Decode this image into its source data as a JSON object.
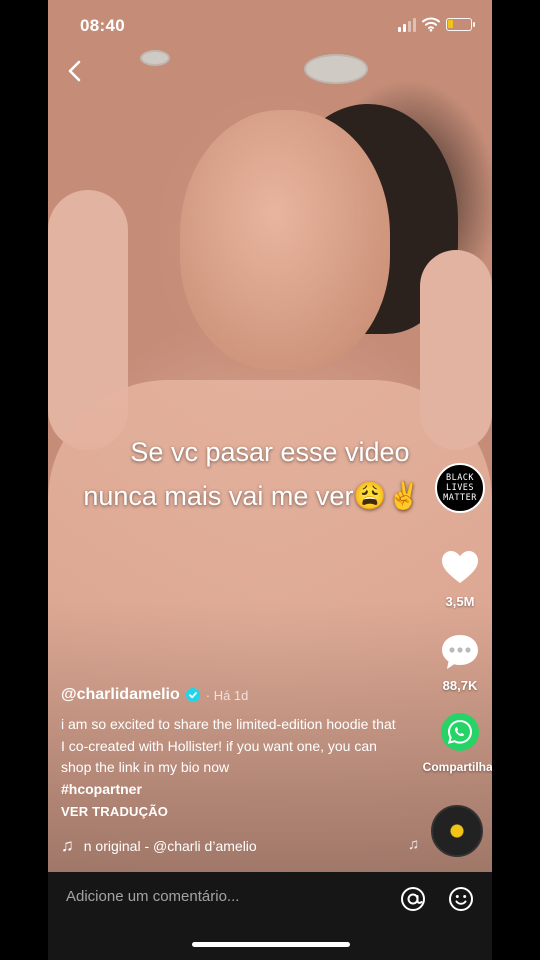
{
  "status_bar": {
    "time": "08:40",
    "battery_level": 0.25,
    "battery_color": "#f2c515"
  },
  "nav": {
    "back_icon": "chevron-left-icon"
  },
  "video": {
    "caption_line1": "Se vc pasar esse video",
    "caption_line2": "nunca mais vai me ver😩✌️",
    "badge": [
      "BLACK",
      "LIVES",
      "MATTER"
    ]
  },
  "actions": {
    "likes": "3,5M",
    "comments": "88,7K",
    "share_label": "Compartilhar",
    "share_color": "#25d366"
  },
  "post": {
    "username": "@charlidamelio",
    "verified_color": "#20d5ec",
    "time_ago": "· Há 1d",
    "description": "i am so excited to share the limited-edition hoodie that I co-created with Hollister! if you want one, you can shop the link in my bio now",
    "hashtag": "#hcopartner",
    "translate_label": "VER TRADUÇÃO",
    "music": "n original - @charli d’amelio"
  },
  "comment_bar": {
    "placeholder": "Adicione um comentário..."
  }
}
